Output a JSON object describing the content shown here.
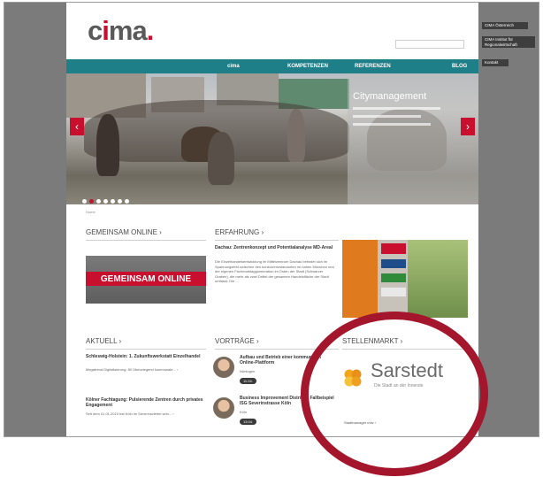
{
  "header": {
    "logo_left": "c",
    "logo_i": "i",
    "logo_right": "ma",
    "logo_dot": "."
  },
  "nav": {
    "items": [
      "cima",
      "KOMPETENZEN",
      "REFERENZEN",
      "BLOG"
    ]
  },
  "hero": {
    "title": "Citymanagement",
    "prev_icon": "chevron-left-icon",
    "next_icon": "chevron-right-icon"
  },
  "breadcrumb": "Home",
  "sections": {
    "gemeinsam": {
      "title": "GEMEINSAM ONLINE ›",
      "banner": "GEMEINSAM ONLINE"
    },
    "erfahrung": {
      "title": "ERFAHRUNG ›",
      "headline": "Dachau: Zentrenkonzept und Potentialanalyse MD-Areal",
      "body": "Die Einzelhandelsentwicklung im Mittelzentrum Dachau befindet sich im Spannungsfeld zwischen den konkurrenzstandorten im nahen München und der eigenen Fachmarktagglomeration im Osten der Stadt (Schwarzer Graben), die mehr als zwei Drittel der gesamten Handelsfläche der Stadt umfasst. Die ..."
    },
    "aktuell": {
      "title": "AKTUELL ›",
      "items": [
        {
          "title": "Schleswig-Holstein: 1. Zukunftswerkstatt Einzelhandel",
          "text": "Megatrend Digitalisierung: 80 Überwiegend kommunale... ›"
        },
        {
          "title": "Kölner Fachtagung: Pulsierende Zentren durch privates Engagement",
          "text": "Seit dem 01.01.2010 hat Köln im Severinsviertel sein... ›"
        }
      ]
    },
    "vortraege": {
      "title": "VORTRÄGE ›",
      "items": [
        {
          "title": "Aufbau und Betrieb einer kommunalen Online-Plattform",
          "place": "Nürtingen",
          "date": "11.04."
        },
        {
          "title": "Business Improvement Districts: Fallbeispiel ISG Severinstrasse Köln",
          "place": "Köln",
          "date": "13.04."
        }
      ]
    },
    "stellenmarkt": {
      "title": "STELLENMARKT ›",
      "company": "Sarstedt",
      "tagline": "Die Stadt an der Innerste",
      "link": "Stadtmanager m/w ›"
    }
  },
  "side_links": [
    "CIMA Österreich",
    "CIMA Institut für Regionalwirtschaft",
    "Kontakt"
  ],
  "colors": {
    "brand_red": "#c8102e",
    "nav_teal": "#1f7f88",
    "highlight_circle": "#a3162c"
  }
}
